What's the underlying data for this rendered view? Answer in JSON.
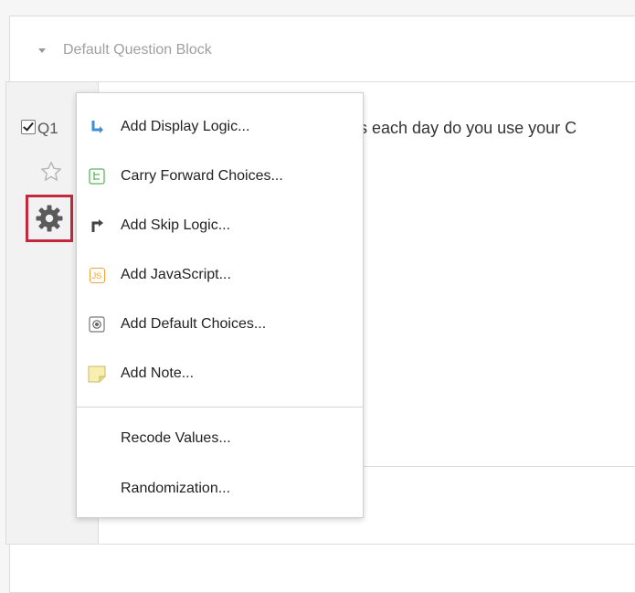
{
  "block": {
    "title": "Default Question Block"
  },
  "question": {
    "number": "Q1",
    "text_visible": "es each day do you use your C",
    "checked": true
  },
  "menu": {
    "items": [
      {
        "label": "Add Display Logic...",
        "icon": "display-logic-icon",
        "color": "#3d8fd6"
      },
      {
        "label": "Carry Forward Choices...",
        "icon": "carry-forward-icon",
        "color": "#5cb85c"
      },
      {
        "label": "Add Skip Logic...",
        "icon": "skip-logic-icon",
        "color": "#444444"
      },
      {
        "label": "Add JavaScript...",
        "icon": "javascript-icon",
        "color": "#f2a33a"
      },
      {
        "label": "Add Default Choices...",
        "icon": "default-choices-icon",
        "color": "#666666"
      },
      {
        "label": "Add Note...",
        "icon": "note-icon",
        "color": "#f0e39a"
      }
    ],
    "secondary_items": [
      {
        "label": "Recode Values..."
      },
      {
        "label": "Randomization..."
      }
    ]
  },
  "colors": {
    "highlight": "#c4283c"
  }
}
